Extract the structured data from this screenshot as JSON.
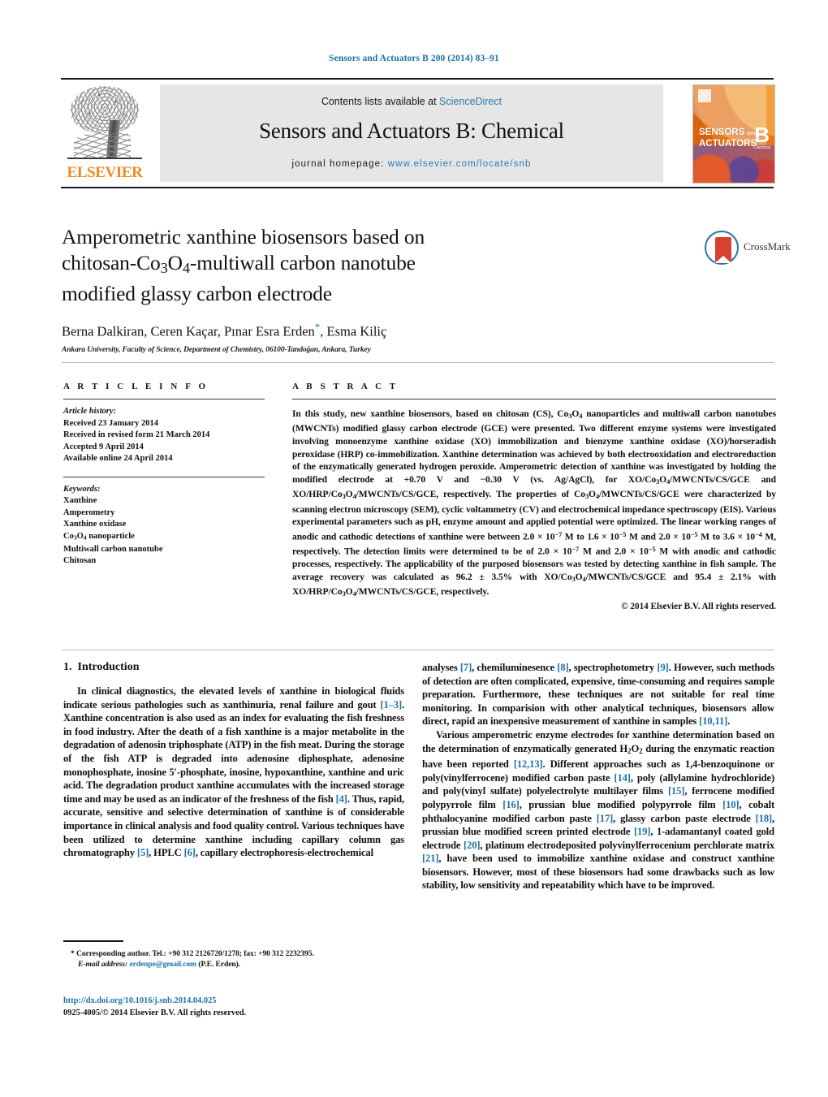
{
  "running_head": "Sensors and Actuators B 200 (2014) 83–91",
  "masthead": {
    "publisher": "ELSEVIER",
    "contents_prefix": "Contents lists available at ",
    "contents_link": "ScienceDirect",
    "journal_title": "Sensors and Actuators B: Chemical",
    "homepage_prefix": "journal homepage: ",
    "homepage_url": "www.elsevier.com/locate/snb",
    "cover": {
      "line1": "SENSORS",
      "line1_small": "and",
      "line2": "ACTUATORS",
      "letter": "B",
      "letter_sub": "Chemical"
    }
  },
  "article": {
    "title": "Amperometric xanthine biosensors based on chitosan-Co3O4-multiwall carbon nanotube modified glassy carbon electrode",
    "title_line1": "Amperometric xanthine biosensors based on",
    "title_line2_a": "chitosan-Co",
    "title_line2_sub1": "3",
    "title_line2_b": "O",
    "title_line2_sub2": "4",
    "title_line2_c": "-multiwall carbon nanotube",
    "title_line3": "modified glassy carbon electrode",
    "authors": "Berna Dalkiran, Ceren Kaçar, Pınar Esra Erden",
    "authors_tail": ", Esma Kiliç",
    "corresponding_marker": "*",
    "affiliation": "Ankara University, Faculty of Science, Department of Chemistry, 06100-Tandoğan, Ankara, Turkey",
    "crossmark_label": "CrossMark"
  },
  "article_info": {
    "heading": "A R T I C L E   I N F O",
    "history_label": "Article history:",
    "history": [
      "Received 23 January 2014",
      "Received in revised form 21 March 2014",
      "Accepted 9 April 2014",
      "Available online 24 April 2014"
    ],
    "keywords_label": "Keywords:",
    "keywords": [
      "Xanthine",
      "Amperometry",
      "Xanthine oxidase",
      "Co3O4 nanoparticle",
      "Multiwall carbon nanotube",
      "Chitosan"
    ]
  },
  "abstract": {
    "heading": "A B S T R A C T",
    "copyright": "© 2014 Elsevier B.V. All rights reserved."
  },
  "body": {
    "section1_number": "1.",
    "section1_title": "Introduction"
  },
  "footnote": {
    "marker": "*",
    "text": "Corresponding author. Tel.: +90 312 2126720/1278; fax: +90 312 2232395.",
    "email_label": "E-mail address:",
    "email": "erdenpe@gmail.com",
    "email_owner": "(P.E. Erden)."
  },
  "footer": {
    "doi": "http://dx.doi.org/10.1016/j.snb.2014.04.025",
    "issn_line": "0925-4005/© 2014 Elsevier B.V. All rights reserved."
  },
  "colors": {
    "link": "#1d71a8",
    "band": "#e6e6e6",
    "elsevier_orange": "#f08a1c"
  }
}
